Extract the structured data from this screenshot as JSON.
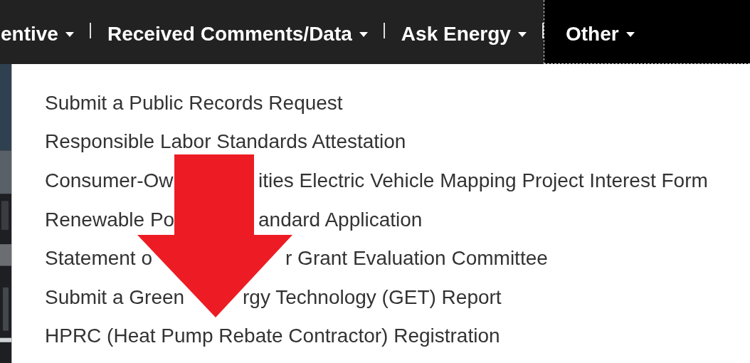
{
  "nav": [
    {
      "label": "entive",
      "selected": false
    },
    {
      "label": "Received Comments/Data",
      "selected": false
    },
    {
      "label": "Ask Energy",
      "selected": false
    },
    {
      "label": "Other",
      "selected": true
    }
  ],
  "menu": {
    "items": [
      {
        "parts": [
          "Submit a Public Records Request"
        ]
      },
      {
        "parts": [
          "Responsible Labor Standards Attestation"
        ]
      },
      {
        "parts": [
          "Consumer-Ow",
          "ities Electric Vehicle Mapping Project Interest Form"
        ]
      },
      {
        "parts": [
          "Renewable Po",
          "andard Application"
        ]
      },
      {
        "parts": [
          "Statement o",
          "r Grant Evaluation Committee"
        ]
      },
      {
        "parts": [
          "Submit a Green",
          "rgy Technology (GET) Report"
        ]
      },
      {
        "parts": [
          "HPRC (Heat Pump Rebate Contractor) Registration"
        ]
      }
    ]
  },
  "overlay": {
    "kind": "arrow"
  }
}
